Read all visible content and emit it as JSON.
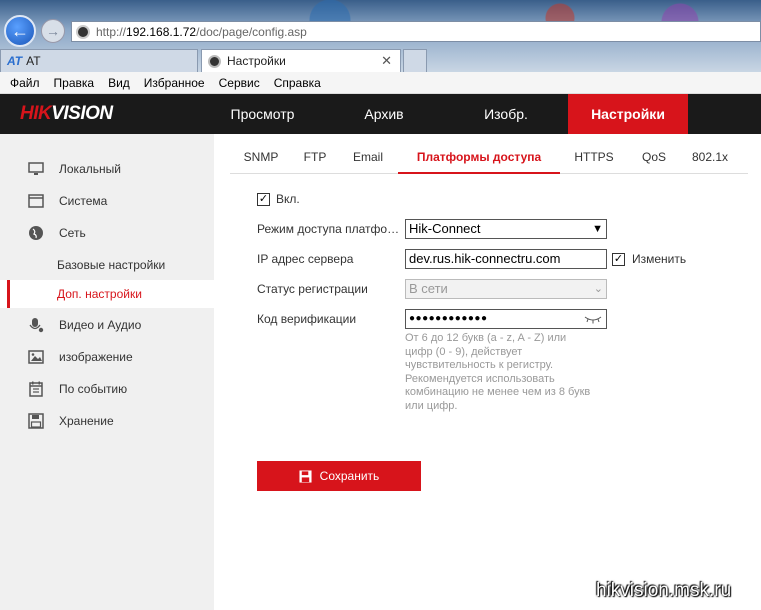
{
  "browser": {
    "address": {
      "prefix": "http://",
      "host": "192.168.1.72",
      "path": "/doc/page/config.asp"
    },
    "tabs": [
      {
        "label": "AT"
      },
      {
        "label": "Настройки"
      }
    ],
    "menu": [
      "Файл",
      "Правка",
      "Вид",
      "Избранное",
      "Сервис",
      "Справка"
    ]
  },
  "header": {
    "logo_part1": "HIK",
    "logo_part2": "VISION",
    "nav": [
      "Просмотр",
      "Архив",
      "Изобр.",
      "Настройки"
    ],
    "active_nav": "Настройки"
  },
  "sidebar": {
    "items": [
      {
        "label": "Локальный",
        "icon": "monitor-icon"
      },
      {
        "label": "Система",
        "icon": "system-window-icon"
      },
      {
        "label": "Сеть",
        "icon": "globe-icon"
      },
      {
        "label": "Базовые настройки",
        "sub": true
      },
      {
        "label": "Доп. настройки",
        "sub": true,
        "active": true
      },
      {
        "label": "Видео и Аудио",
        "icon": "microphone-icon"
      },
      {
        "label": "изображение",
        "icon": "image-icon"
      },
      {
        "label": "По событию",
        "icon": "calendar-icon"
      },
      {
        "label": "Хранение",
        "icon": "save-disk-icon"
      }
    ]
  },
  "subtabs": [
    "SNMP",
    "FTP",
    "Email",
    "Платформы доступа",
    "HTTPS",
    "QoS",
    "802.1x"
  ],
  "active_subtab": "Платформы доступа",
  "form": {
    "enable_label": "Вкл.",
    "enable_checked": true,
    "mode_label": "Режим доступа платфор…",
    "mode_value": "Hik-Connect",
    "server_label": "IP адрес сервера",
    "server_value": "dev.rus.hik-connectru.com",
    "change_label": "Изменить",
    "change_checked": true,
    "status_label": "Статус регистрации",
    "status_value": "В сети",
    "code_label": "Код верификации",
    "code_value": "●●●●●●●●●●●●",
    "hint": "От 6 до 12 букв (a - z, A - Z) или цифр (0 - 9), действует чувствительность к регистру. Рекомендуется использовать комбинацию не менее чем из 8 букв или цифр."
  },
  "save_label": "Сохранить",
  "watermark": "hikvision.msk.ru",
  "colors": {
    "accent": "#d7141b",
    "header_bg": "#1a1a1a",
    "sidebar_bg": "#f0f0f0"
  }
}
